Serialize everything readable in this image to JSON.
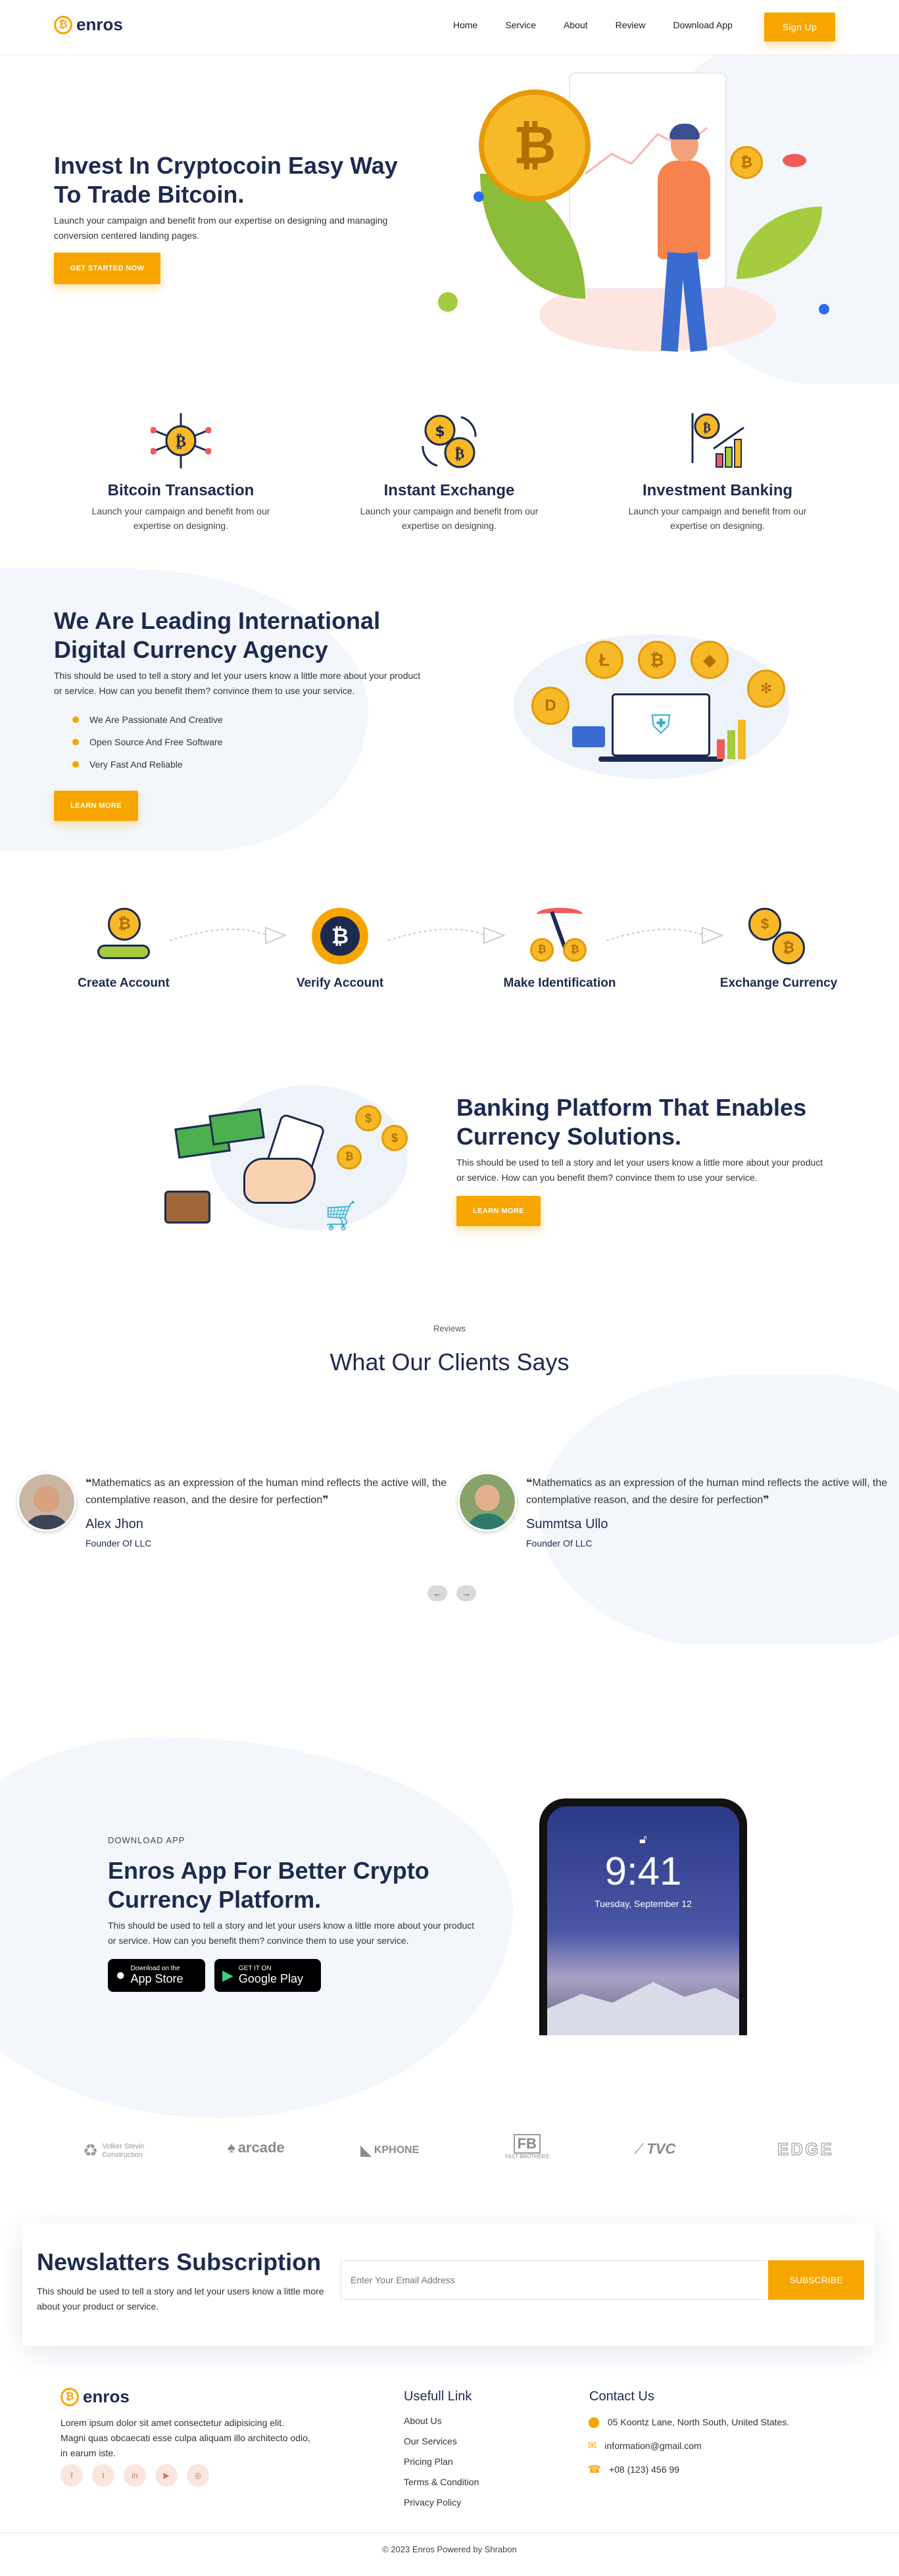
{
  "brand": {
    "name": "enros",
    "color": "#f7a600"
  },
  "nav": {
    "items": [
      "Home",
      "Service",
      "About",
      "Review",
      "Download App"
    ],
    "signup": "Sign Up"
  },
  "hero": {
    "title": "Invest In Cryptocoin Easy Way To Trade Bitcoin.",
    "text": "Launch your campaign and benefit from our expertise on designing and managing conversion centered landing pages.",
    "cta": "GET STARTED NOW"
  },
  "features": [
    {
      "title": "Bitcoin Transaction",
      "text": "Launch your campaign and benefit from our expertise on designing.",
      "icon": "bitcoin-network-icon"
    },
    {
      "title": "Instant Exchange",
      "text": "Launch your campaign and benefit from our expertise on designing.",
      "icon": "coin-exchange-icon"
    },
    {
      "title": "Investment Banking",
      "text": "Launch your campaign and benefit from our expertise on designing.",
      "icon": "growth-chart-icon"
    }
  ],
  "about": {
    "title": "We Are Leading International Digital Currency Agency",
    "text": "This should be used to tell a story and let your users know a little more about your product or service. How can you benefit them? convince them to use your service.",
    "points": [
      "We Are Passionate And Creative",
      "Open Source And Free Software",
      "Very Fast And Reliable"
    ],
    "cta": "LEARN MORE"
  },
  "steps": [
    "Create Account",
    "Verify Account",
    "Make Identification",
    "Exchange Currency"
  ],
  "banking": {
    "title": "Banking Platform That Enables Currency Solutions.",
    "text": "This should be used to tell a story and let your users know a little more about your product or service. How can you benefit them? convince them to use your service.",
    "cta": "LEARN MORE"
  },
  "reviews": {
    "eyebrow": "Reviews",
    "title": "What Our Clients Says",
    "items": [
      {
        "quote": "Mathematics as an expression of the human mind reflects the active will, the contemplative reason, and the desire for perfection",
        "name": "Alex Jhon",
        "role": "Founder Of LLC"
      },
      {
        "quote": "Mathematics as an expression of the human mind reflects the active will, the contemplative reason, and the desire for perfection",
        "name": "Summtsa Ullo",
        "role": "Founder Of LLC"
      }
    ]
  },
  "app": {
    "eyebrow": "DOWNLOAD APP",
    "title": "Enros App For Better Crypto Currency Platform.",
    "text": "This should be used to tell a story and let your users know a little more about your product or service. How can you benefit them? convince them to use your service.",
    "appstore_small": "Download on the",
    "appstore_big": "App Store",
    "gplay_small": "GET IT ON",
    "gplay_big": "Google Play",
    "phone_time": "9:41",
    "phone_date": "Tuesday, September 12"
  },
  "partners": [
    "Volker Stevin Construction",
    "arcade",
    "KPHONE",
    "FAST BROTHERS",
    "TVC",
    "EDGE"
  ],
  "newsletter": {
    "title": "Newslatters Subscription",
    "text": "This should be used to tell a story and let your users know a little more about your product or service.",
    "placeholder": "Enter Your Email Address",
    "button": "SUBSCRIBE"
  },
  "footer": {
    "about": "Lorem ipsum dolor sit amet consectetur adipisicing elit. Magni quas obcaecati esse culpa aliquam illo architecto odio, in earum iste.",
    "links_title": "Usefull Link",
    "links": [
      "About Us",
      "Our Services",
      "Pricing Plan",
      "Terms & Condition",
      "Privacy Policy"
    ],
    "contact_title": "Contact Us",
    "address": "05 Koontz Lane, North South, United States.",
    "email": "information@gmail.com",
    "phone": "+08 (123) 456 99",
    "copyright": "© 2023 Enros Powered by Shrabon"
  }
}
